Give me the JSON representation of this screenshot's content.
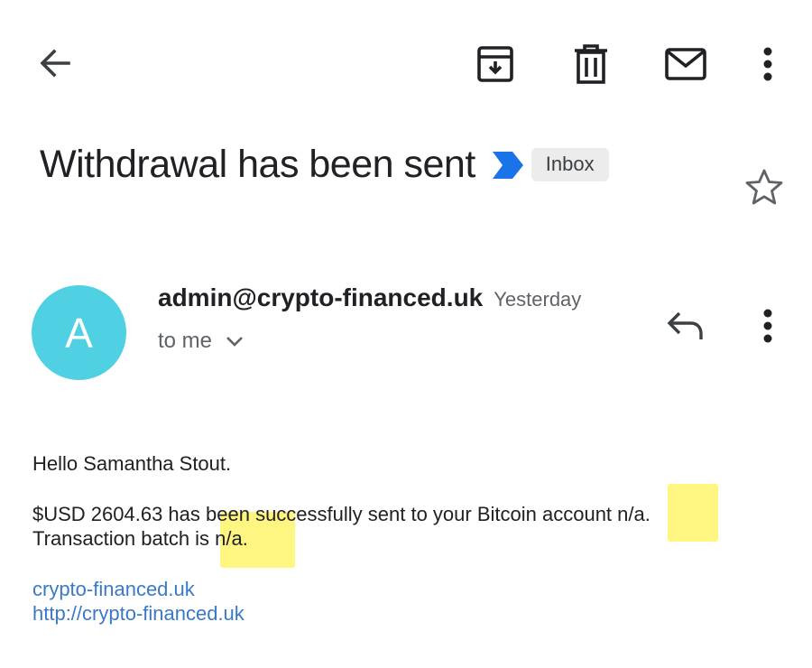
{
  "toolbar": {
    "back_icon": "arrow-back-icon",
    "archive_icon": "archive-icon",
    "delete_icon": "delete-icon",
    "mark_unread_icon": "mail-icon",
    "more_icon": "more-vert-icon"
  },
  "email": {
    "subject": "Withdrawal has been sent",
    "label": "Inbox",
    "important_marker_color": "#1a73e8",
    "starred": false,
    "sender": {
      "avatar_letter": "A",
      "avatar_color": "#4fd0e3",
      "address": "admin@crypto-financed.uk",
      "date": "Yesterday",
      "recipient": "to me"
    },
    "body": {
      "greeting": "Hello Samantha Stout.",
      "line1": "$USD 2604.63 has been successfully sent to your Bitcoin account n/a.",
      "line2": "Transaction batch is n/a.",
      "links": [
        "crypto-financed.uk",
        "http://crypto-financed.uk"
      ]
    }
  },
  "highlight_color": "#fff028"
}
